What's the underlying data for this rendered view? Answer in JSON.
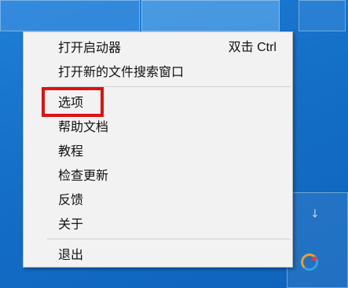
{
  "context_menu": {
    "items": [
      {
        "label": "打开启动器",
        "shortcut": "双击 Ctrl"
      },
      {
        "label": "打开新的文件搜索窗口"
      },
      {
        "label": "选项"
      },
      {
        "label": "帮助文档"
      },
      {
        "label": "教程"
      },
      {
        "label": "检查更新"
      },
      {
        "label": "反馈"
      },
      {
        "label": "关于"
      },
      {
        "label": "退出"
      }
    ]
  },
  "annotation": {
    "highlighted_item": "选项",
    "color": "#e01010"
  },
  "desktop": {
    "background_color": "#1570c8"
  },
  "tray": {
    "overflow_arrow": "↓",
    "app_icon": "launcher-tray-icon"
  }
}
